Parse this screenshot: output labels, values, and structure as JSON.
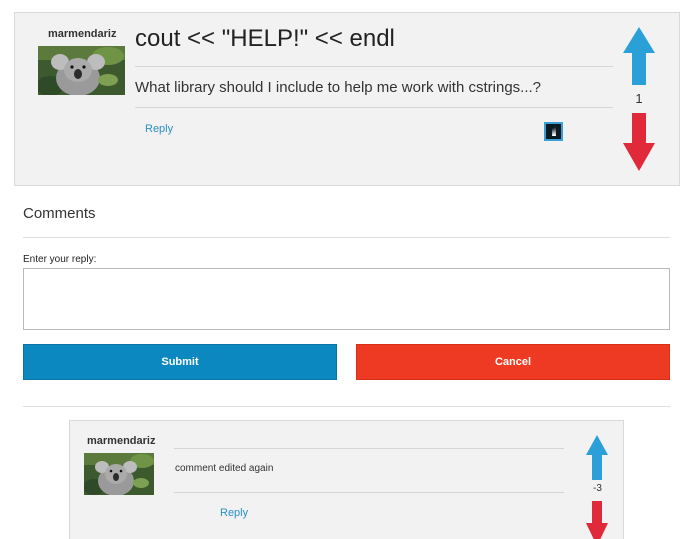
{
  "post": {
    "username": "marmendariz",
    "title": "cout << \"HELP!\" << endl",
    "body": "What library should I include to help me work with cstrings...?",
    "reply_label": "Reply",
    "vote_count": "1"
  },
  "comments_section": {
    "heading": "Comments",
    "reply_label": "Enter your reply:",
    "reply_value": "",
    "submit_label": "Submit",
    "cancel_label": "Cancel"
  },
  "comments": [
    {
      "username": "marmendariz",
      "body": "comment edited again",
      "reply_label": "Reply",
      "vote_count": "-3"
    }
  ],
  "colors": {
    "upvote": "#2b9fd8",
    "downvote": "#e02a3a",
    "submit": "#0b88bf",
    "cancel": "#ee3a22",
    "link": "#2a8fc5"
  },
  "icons": {
    "avatar": "koala-avatar",
    "edit": "edit-icon",
    "upvote": "arrow-up-icon",
    "downvote": "arrow-down-icon"
  }
}
